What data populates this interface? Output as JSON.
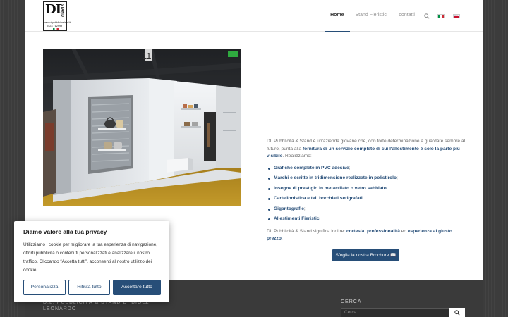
{
  "header": {
    "logo": {
      "letters": "DL",
      "side_text": "STAND",
      "url": "www.dlpubblicitastand.it",
      "tel": "0423 712999"
    },
    "nav": [
      {
        "label": "Home",
        "active": true
      },
      {
        "label": "Stand Fieristici",
        "active": false
      },
      {
        "label": "contatti",
        "active": false
      }
    ],
    "icons": {
      "search": "search-icon",
      "lang_it": "italian-flag-icon",
      "lang_en": "english-flag-icon"
    }
  },
  "intro": {
    "p1_a": "DL Pubblicità & Stand è un'azienda giovane che, con forte determinazione a guardare sempre al futuro, punta alla ",
    "p1_b": "fornitura di un servizio completo di cui l'allestimento è solo la parte più visibile",
    "p1_c": ". Realizziamo:"
  },
  "services": [
    "Grafiche complete in PVC adesive",
    "Marchi e scritte in tridimensione realizzate in polistirolo",
    "Insegne di prestigio in metacrilato o vetro sabbiato",
    "Cartellonistica e teli borchiati serigrafati",
    "Gigantografie",
    "Allestimenti Fieristici"
  ],
  "services_sep": [
    ";",
    ";",
    ";",
    ";",
    ";",
    ""
  ],
  "outro": {
    "a": "DL Pubblicità & Stand significa inoltre: ",
    "b": "cortesia",
    "c": ", ",
    "d": "professionalità",
    "e": " ed ",
    "f": "esperienza al giusto prezzo",
    "g": "."
  },
  "brochure_button": "Sfoglia la nostra Brochure 📖",
  "footer": {
    "title": "D.L. PUBBLICITÀ & STAND DI BIOLZI LEONARDO",
    "cerca_label": "CERCA",
    "search_placeholder": "Cerca"
  },
  "cookie": {
    "title": "Diamo valore alla tua privacy",
    "body": "Utilizziamo i cookie per migliorare la tua esperienza di navigazione, offrirti pubblicità o contenuti personalizzati e analizzare il nostro traffico. Cliccando “Accetta tutti”, acconsenti al nostro utilizzo dei cookie.",
    "btn_customize": "Personalizza",
    "btn_reject": "Rifiuta tutto",
    "btn_accept": "Accettare tutto"
  },
  "colors": {
    "accent": "#274e78",
    "footer_bg": "#3a3a3a",
    "page_bg": "#3c3c3c"
  }
}
